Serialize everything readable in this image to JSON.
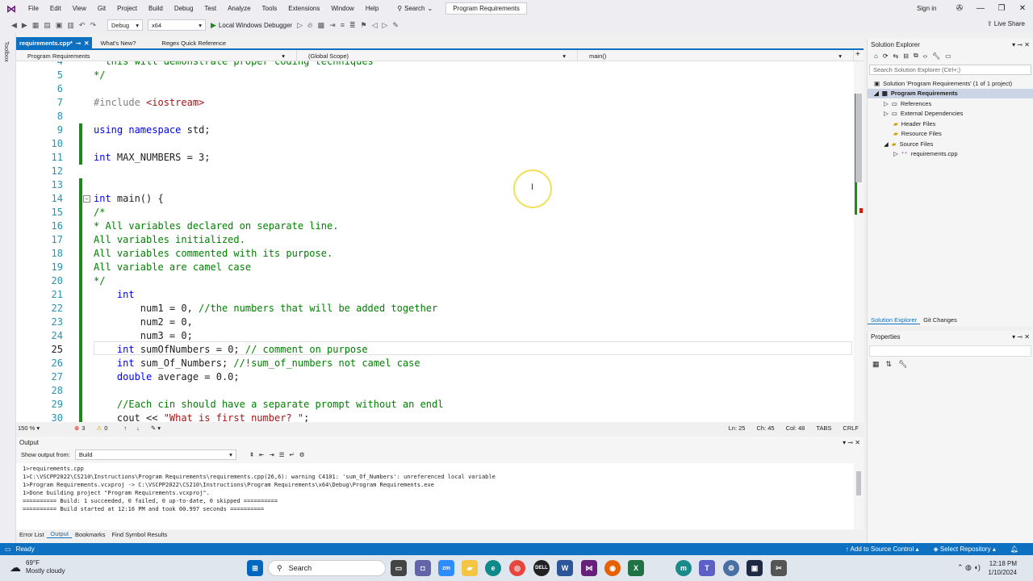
{
  "menubar": {
    "items": [
      "File",
      "Edit",
      "View",
      "Git",
      "Project",
      "Build",
      "Debug",
      "Test",
      "Analyze",
      "Tools",
      "Extensions",
      "Window",
      "Help"
    ],
    "search_label": "Search",
    "window_title": "Program Requirements",
    "sign_in": "Sign in"
  },
  "toolbar": {
    "config": "Debug",
    "platform": "x64",
    "run_label": "Local Windows Debugger",
    "live_share": "Live Share"
  },
  "toolbox_label": "Toolbox",
  "doc_tabs": [
    {
      "label": "requirements.cpp*",
      "active": true
    },
    {
      "label": "What's New?",
      "active": false
    },
    {
      "label": "Regex Quick Reference",
      "active": false
    }
  ],
  "navbar": {
    "project": "Program Requirements",
    "scope": "(Global Scope)",
    "member": "main()"
  },
  "code": {
    "current_line": "25",
    "lines": [
      {
        "n": "4",
        "t": "  this will demonstrate proper coding techniques"
      },
      {
        "n": "5",
        "t": "*/"
      },
      {
        "n": "6",
        "t": ""
      },
      {
        "n": "7",
        "t": "#include <iostream>"
      },
      {
        "n": "8",
        "t": ""
      },
      {
        "n": "9",
        "t": "using namespace std;"
      },
      {
        "n": "10",
        "t": ""
      },
      {
        "n": "11",
        "t": "int MAX_NUMBERS = 3;"
      },
      {
        "n": "12",
        "t": ""
      },
      {
        "n": "13",
        "t": ""
      },
      {
        "n": "14",
        "t": "int main() {"
      },
      {
        "n": "15",
        "t": "/*"
      },
      {
        "n": "16",
        "t": "* All variables declared on separate line."
      },
      {
        "n": "17",
        "t": "All variables initialized."
      },
      {
        "n": "18",
        "t": "All variables commented with its purpose."
      },
      {
        "n": "19",
        "t": "All variable are camel case"
      },
      {
        "n": "20",
        "t": "*/"
      },
      {
        "n": "21",
        "t": "    int"
      },
      {
        "n": "22",
        "t": "        num1 = 0, //the numbers that will be added together"
      },
      {
        "n": "23",
        "t": "        num2 = 0,"
      },
      {
        "n": "24",
        "t": "        num3 = 0;"
      },
      {
        "n": "25",
        "t": "    int sumOfNumbers = 0; // comment on purpose"
      },
      {
        "n": "26",
        "t": "    int sum_Of_Numbers; //!sum_of_numbers not camel case"
      },
      {
        "n": "27",
        "t": "    double average = 0.0;"
      },
      {
        "n": "28",
        "t": ""
      },
      {
        "n": "29",
        "t": "    //Each cin should have a separate prompt without an endl"
      },
      {
        "n": "30",
        "t": "    cout << \"What is first number? \";"
      }
    ]
  },
  "editor_status": {
    "zoom": "150 %",
    "errors": "3",
    "warnings": "0",
    "ln": "Ln: 25",
    "ch": "Ch: 45",
    "col": "Col: 48",
    "tabs": "TABS",
    "eol": "CRLF"
  },
  "output": {
    "title": "Output",
    "show_from_label": "Show output from:",
    "show_from_value": "Build",
    "lines": [
      "1>requirements.cpp",
      "1>C:\\VSCPP2022\\CS210\\Instructions\\Program Requirements\\requirements.cpp(26,6): warning C4101: 'sum_Of_Numbers': unreferenced local variable",
      "1>Program Requirements.vcxproj -> C:\\VSCPP2022\\CS210\\Instructions\\Program Requirements\\x64\\Debug\\Program Requirements.exe",
      "1>Done building project \"Program Requirements.vcxproj\".",
      "========== Build: 1 succeeded, 0 failed, 0 up-to-date, 0 skipped ==========",
      "========== Build started at 12:16 PM and took 00.997 seconds =========="
    ],
    "tabs": [
      "Error List",
      "Output",
      "Bookmarks",
      "Find Symbol Results"
    ],
    "active_tab": "Output"
  },
  "solution_explorer": {
    "title": "Solution Explorer",
    "search_placeholder": "Search Solution Explorer (Ctrl+;)",
    "tree": [
      {
        "label": "Solution 'Program Requirements' (1 of 1 project)",
        "indent": 0
      },
      {
        "label": "Program Requirements",
        "indent": 1,
        "selected": true
      },
      {
        "label": "References",
        "indent": 2
      },
      {
        "label": "External Dependencies",
        "indent": 2
      },
      {
        "label": "Header Files",
        "indent": 2
      },
      {
        "label": "Resource Files",
        "indent": 2
      },
      {
        "label": "Source Files",
        "indent": 2
      },
      {
        "label": "requirements.cpp",
        "indent": 3
      }
    ],
    "tabs": [
      "Solution Explorer",
      "Git Changes"
    ]
  },
  "properties": {
    "title": "Properties"
  },
  "statusbar": {
    "ready": "Ready",
    "add_source_control": "Add to Source Control",
    "select_repository": "Select Repository"
  },
  "taskbar": {
    "temp": "69°F",
    "weather": "Mostly cloudy",
    "search": "Search",
    "time": "12:18 PM",
    "date": "1/10/2024"
  },
  "colors": {
    "accent": "#0e70c0",
    "keyword": "#0000ff",
    "comment": "#008000",
    "string": "#a31515",
    "line_number": "#2b91af",
    "change_bar": "#1b8a1b"
  }
}
